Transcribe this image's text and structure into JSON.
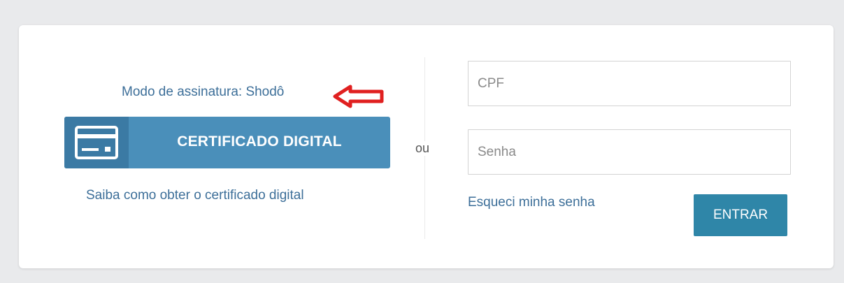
{
  "signature_mode": {
    "label": "Modo de assinatura: Shodô"
  },
  "certificate": {
    "button_label": "CERTIFICADO DIGITAL",
    "icon": "credit-card-icon",
    "help_link": "Saiba como obter o certificado digital"
  },
  "separator": {
    "text": "ou"
  },
  "login": {
    "cpf_placeholder": "CPF",
    "cpf_value": "",
    "password_placeholder": "Senha",
    "password_value": "",
    "forgot_link": "Esqueci minha senha",
    "submit_label": "ENTRAR"
  },
  "annotation": {
    "icon": "red-arrow-left-icon"
  },
  "colors": {
    "accent_link": "#3d6f99",
    "cert_button": "#4a8fba",
    "cert_icon_bg": "#3b7aa4",
    "login_button": "#2f86a8",
    "annotation_arrow": "#e02020"
  }
}
